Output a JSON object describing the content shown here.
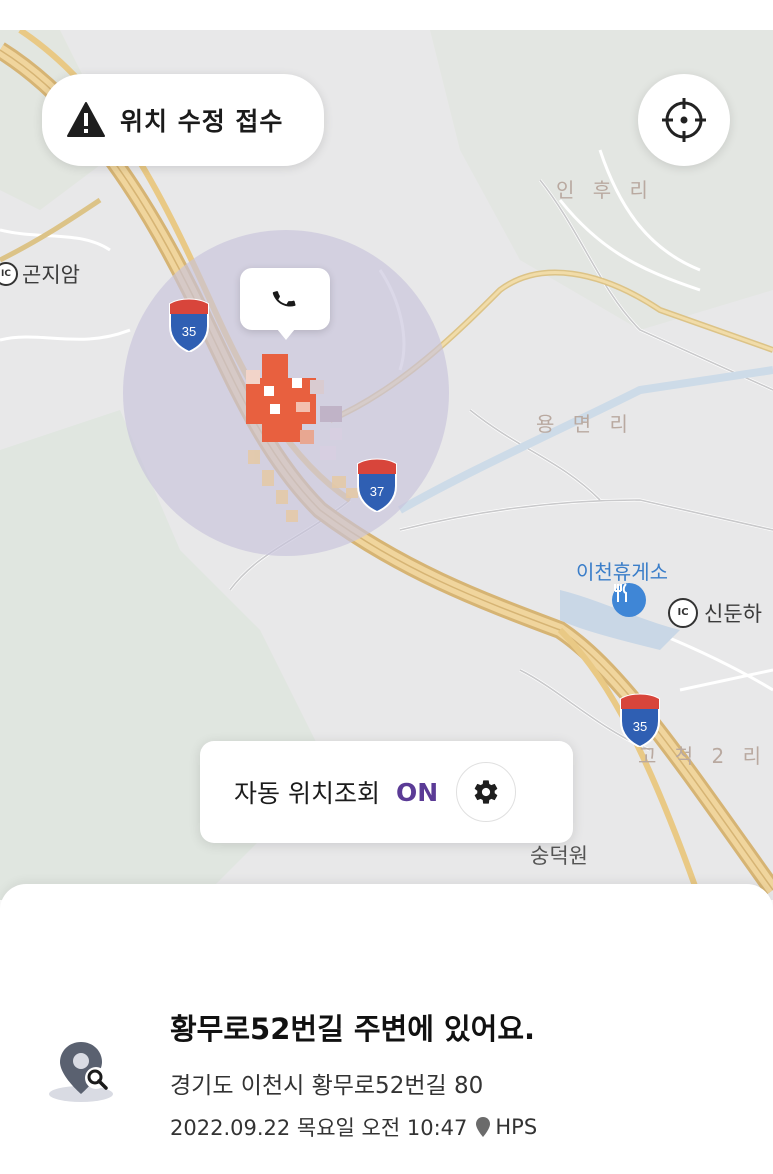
{
  "map": {
    "report_button": {
      "label": "위치 수정 접수",
      "icon": "warning-icon"
    },
    "locate_button": {
      "icon": "crosshair-icon"
    },
    "phone_bubble": {
      "icon": "phone-icon"
    },
    "labels": {
      "gonjiam": "곤지암",
      "inhuri": "인 후 리",
      "yongmyeonri": "용 면 리",
      "rest_area": "이천휴게소",
      "sindun": "신둔하",
      "gocheok2ri": "고 척 2 리",
      "sungdeokwon": "숭덕원"
    },
    "highway_shields": [
      "35",
      "37",
      "35"
    ],
    "ic_badge": "IC",
    "auto_location": {
      "label": "자동 위치조회",
      "status": "ON",
      "icon": "gear-icon"
    }
  },
  "sheet": {
    "headline": "황무로52번길 주변에 있어요.",
    "address": "경기도 이천시 황무로52번길 80",
    "datetime": "2022.09.22 목요일 오전 10:47",
    "source": "HPS",
    "icon": "location-search-icon"
  },
  "colors": {
    "accent_on": "#5b3b96",
    "marker": "#e8603f",
    "road": "#e8c98a",
    "circle": "#c7c3dc"
  }
}
